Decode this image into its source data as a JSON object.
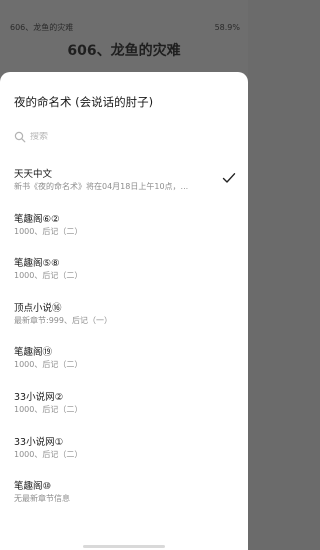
{
  "reader": {
    "chapter_short": "606、龙鱼的灾难",
    "progress": "58.9%",
    "chapter_title": "606、龙鱼的灾难"
  },
  "sheet": {
    "title": "夜的命名术 (会说话的肘子)",
    "search_placeholder": "搜索",
    "sources": [
      {
        "name": "天天中文",
        "latest": "新书《夜的命名术》将在04月18日上午10点，...",
        "selected": true
      },
      {
        "name": "笔趣阁⑥②",
        "latest": "1000、后记（二）",
        "selected": false
      },
      {
        "name": "笔趣阁⑤⑧",
        "latest": "1000、后记（二）",
        "selected": false
      },
      {
        "name": "顶点小说⑯",
        "latest": "最新章节:999、后记（一）",
        "selected": false
      },
      {
        "name": "笔趣阁⑲",
        "latest": "1000、后记（二）",
        "selected": false
      },
      {
        "name": "33小说网②",
        "latest": "1000、后记（二）",
        "selected": false
      },
      {
        "name": "33小说网①",
        "latest": "1000、后记（二）",
        "selected": false
      },
      {
        "name": "笔趣阁⑩",
        "latest": "无最新章节信息",
        "selected": false
      }
    ]
  },
  "colors": {
    "overlay": "#6b6b6b",
    "sheet": "#ffffff",
    "accent_check": "#222222"
  },
  "icons": {
    "search": "search-icon",
    "check": "check-icon"
  }
}
